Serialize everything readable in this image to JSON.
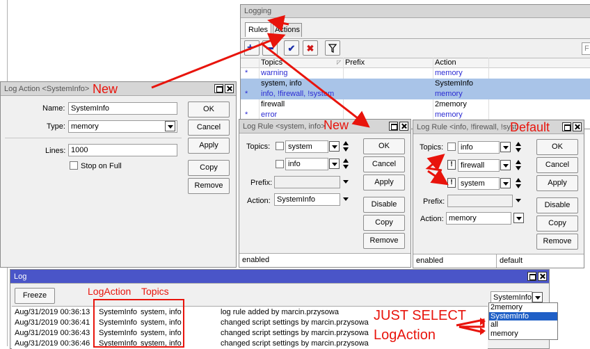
{
  "logging": {
    "title": "Logging",
    "tabs": [
      "Rules",
      "Actions"
    ],
    "columns": [
      "Topics",
      "Prefix",
      "Action"
    ],
    "search_placeholder": "F",
    "rows": [
      {
        "mark": "*",
        "topics": "warning",
        "prefix": "",
        "action": "memory",
        "style": "blue"
      },
      {
        "mark": "",
        "topics": "system, info",
        "prefix": "",
        "action": "SystemInfo",
        "style": "selected"
      },
      {
        "mark": "*",
        "topics": "info, !firewall, !system",
        "prefix": "",
        "action": "memory",
        "style": "selected-blue"
      },
      {
        "mark": "",
        "topics": "firewall",
        "prefix": "",
        "action": "2memory",
        "style": ""
      },
      {
        "mark": "*",
        "topics": "error",
        "prefix": "",
        "action": "memory",
        "style": "blue"
      }
    ]
  },
  "log_action": {
    "title": "Log Action <SystemInfo>",
    "name_label": "Name:",
    "name_value": "SystemInfo",
    "type_label": "Type:",
    "type_value": "memory",
    "lines_label": "Lines:",
    "lines_value": "1000",
    "stop_label": "Stop on Full",
    "buttons": {
      "ok": "OK",
      "cancel": "Cancel",
      "apply": "Apply",
      "copy": "Copy",
      "remove": "Remove"
    }
  },
  "log_rule_1": {
    "title": "Log Rule <system, info>",
    "topics_label": "Topics:",
    "topic1": "system",
    "topic2": "info",
    "prefix_label": "Prefix:",
    "action_label": "Action:",
    "action_value": "SystemInfo",
    "status": "enabled",
    "buttons": {
      "ok": "OK",
      "cancel": "Cancel",
      "apply": "Apply",
      "disable": "Disable",
      "copy": "Copy",
      "remove": "Remove"
    }
  },
  "log_rule_2": {
    "title": "Log Rule <info, !firewall, !syst",
    "topics_label": "Topics:",
    "topic1": "info",
    "topic2": "firewall",
    "topic3": "system",
    "not_mark": "!",
    "prefix_label": "Prefix:",
    "action_label": "Action:",
    "action_value": "memory",
    "status_left": "enabled",
    "status_right": "default",
    "buttons": {
      "ok": "OK",
      "cancel": "Cancel",
      "apply": "Apply",
      "disable": "Disable",
      "copy": "Copy",
      "remove": "Remove"
    }
  },
  "log": {
    "title": "Log",
    "freeze": "Freeze",
    "filter_value": "SystemInfo",
    "filter_options": [
      "2memory",
      "SystemInfo",
      "all",
      "memory"
    ],
    "rows": [
      {
        "time": "Aug/31/2019 00:36:13",
        "buffer": "SystemInfo",
        "topics": "system, info",
        "message": "log rule added by marcin.przysowa"
      },
      {
        "time": "Aug/31/2019 00:36:41",
        "buffer": "SystemInfo",
        "topics": "system, info",
        "message": "changed script settings by marcin.przysowa"
      },
      {
        "time": "Aug/31/2019 00:36:43",
        "buffer": "SystemInfo",
        "topics": "system, info",
        "message": "changed script settings by marcin.przysowa"
      },
      {
        "time": "Aug/31/2019 00:36:46",
        "buffer": "SystemInfo",
        "topics": "system, info",
        "message": "changed script settings by marcin.przysowa"
      }
    ]
  },
  "annotations": {
    "new1": "New",
    "new2": "New",
    "default": "Default",
    "logaction": "LogAction",
    "topics": "Topics",
    "just_select": "JUST SELECT",
    "logaction2": "LogAction"
  },
  "colors": {
    "annotation": "#e8140c",
    "selected_row": "#a9c4e8",
    "active_title": "#4a55c8"
  }
}
